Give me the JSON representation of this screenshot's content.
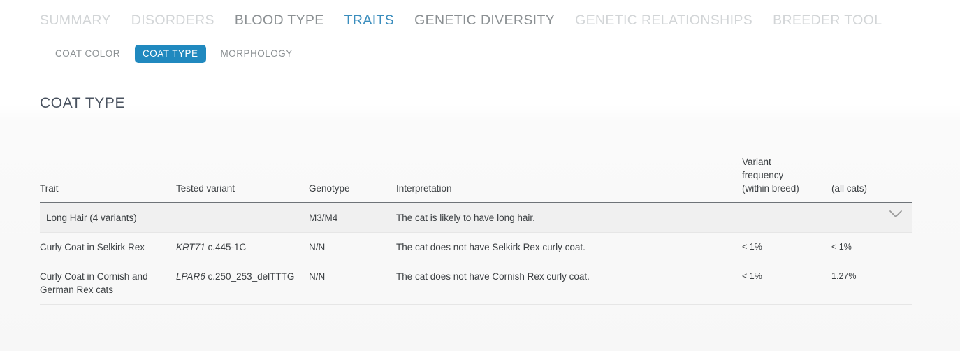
{
  "main_nav": {
    "items": [
      {
        "label": "SUMMARY",
        "state": "dim"
      },
      {
        "label": "DISORDERS",
        "state": "dim"
      },
      {
        "label": "BLOOD TYPE",
        "state": "mid"
      },
      {
        "label": "TRAITS",
        "state": "active"
      },
      {
        "label": "GENETIC DIVERSITY",
        "state": "mid"
      },
      {
        "label": "GENETIC RELATIONSHIPS",
        "state": "dim"
      },
      {
        "label": "BREEDER TOOL",
        "state": "dim"
      }
    ]
  },
  "sub_nav": {
    "items": [
      {
        "label": "COAT COLOR",
        "active": false
      },
      {
        "label": "COAT TYPE",
        "active": true
      },
      {
        "label": "MORPHOLOGY",
        "active": false
      }
    ]
  },
  "section": {
    "title": "COAT TYPE"
  },
  "table": {
    "headers": {
      "trait": "Trait",
      "tested_variant": "Tested variant",
      "genotype": "Genotype",
      "interpretation": "Interpretation",
      "variant_frequency_within_breed": "Variant\nfrequency\n(within breed)",
      "variant_frequency_all_cats": "(all cats)"
    },
    "rows": [
      {
        "trait": "Long Hair (4 variants)",
        "gene": "",
        "variant": "",
        "genotype": "M3/M4",
        "interpretation": "The cat is likely to have long hair.",
        "freq_breed": "",
        "freq_all": "",
        "expandable": true,
        "highlighted": true
      },
      {
        "trait": "Curly Coat in Selkirk Rex",
        "gene": "KRT71",
        "variant": " c.445-1C",
        "genotype": "N/N",
        "interpretation": "The cat does not have Selkirk Rex curly coat.",
        "freq_breed": "< 1%",
        "freq_all": "< 1%",
        "expandable": false,
        "highlighted": false
      },
      {
        "trait": "Curly Coat in Cornish and German Rex cats",
        "gene": "LPAR6",
        "variant": " c.250_253_delTTTG",
        "genotype": "N/N",
        "interpretation": "The cat does not have Cornish Rex curly coat.",
        "freq_breed": "< 1%",
        "freq_all": "1.27%",
        "expandable": false,
        "highlighted": false
      }
    ]
  },
  "colors": {
    "accent_blue": "#2089bf",
    "active_tab_blue": "#3a8dbd",
    "muted_gray": "#8b9093",
    "light_gray": "#d2d5d7",
    "row_highlight": "#f0f0f0"
  }
}
